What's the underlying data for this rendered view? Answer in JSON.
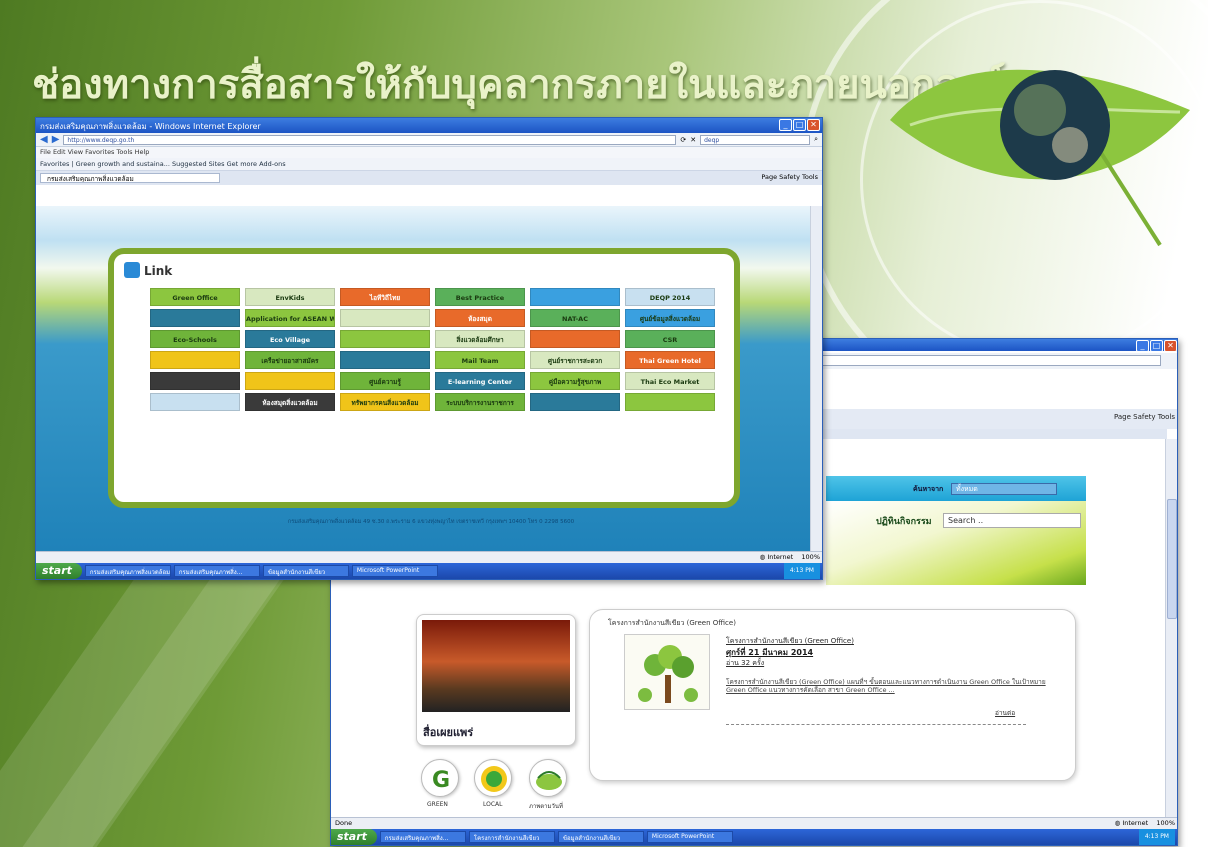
{
  "slide": {
    "title": "ช่องทางการสื่อสารให้กับบุคลากรภายในและภายนอกองค์กร",
    "accent_green": "#6e9a36",
    "ie_blue": "#2b5fb8"
  },
  "front_window": {
    "title_bar": "กรมส่งเสริมคุณภาพสิ่งแวดล้อม - Windows Internet Explorer",
    "address": "http://www.deqp.go.th",
    "search_engine": "deqp",
    "menu": "File  Edit  View  Favorites  Tools  Help",
    "favorites_bar": "Favorites  |  Green growth and sustaina...  Suggested Sites  Get more Add-ons",
    "tab_label": "กรมส่งเสริมคุณภาพสิ่งแวดล้อม",
    "command_bar": "Page  Safety  Tools",
    "link_heading": "Link",
    "banners": [
      [
        "Green Office",
        "EnvKids",
        "ไอทีวิถีไทย",
        "Best Practice",
        "",
        "DEQP 2014"
      ],
      [
        "",
        "Application for ASEAN Workshop",
        "",
        "ห้องสมุด",
        "NAT-AC",
        "ศูนย์ข้อมูลสิ่งแวดล้อม"
      ],
      [
        "Eco-Schools",
        "Eco Village",
        "",
        "สิ่งแวดล้อมศึกษา",
        "",
        "CSR"
      ],
      [
        "",
        "เครือข่ายอาสาสมัคร",
        "",
        "Mail Team",
        "ศูนย์ราชการสะดวก",
        "Thai Green Hotel"
      ],
      [
        "",
        "",
        "ศูนย์ความรู้",
        "E-learning Center",
        "คู่มือความรู้สุขภาพ",
        "Thai Eco Market"
      ],
      [
        "",
        "ห้องสมุดสิ่งแวดล้อม",
        "ทรัพยากรคนสิ่งแวดล้อม",
        "ระบบบริการงานราชการ",
        "",
        ""
      ]
    ],
    "footer_text": "กรมส่งเสริมคุณภาพสิ่งแวดล้อม 49 ซ.30 ถ.พระราม 6 แขวงทุ่งพญาไท เขตราชเทวี กรุงเทพฯ 10400 โทร 0 2298 5600",
    "status_zone": "Internet",
    "zoom": "100%",
    "taskbar": {
      "start": "start",
      "buttons": [
        "กรมส่งเสริมคุณภาพสิ่งแวดล้อม",
        "กรมส่งเสริมคุณภาพสิ่ง...",
        "ข้อมูลสำนักงานสีเขียว",
        "Microsoft PowerPoint"
      ],
      "tray_time": "4:13 PM"
    }
  },
  "back_window": {
    "command_bar": "Page  Safety  Tools",
    "select_label": "ค้นหาจาก",
    "select_value": "ทั้งหมด",
    "activity_label": "ปฏิทินกิจกรรม",
    "search_placeholder": "Search ..",
    "video_label": "สื่อเผยแพร่",
    "icons": [
      {
        "name": "green-icon",
        "label": "GREEN"
      },
      {
        "name": "local-icon",
        "label": "LOCAL"
      },
      {
        "name": "weather-icon",
        "label": "ภาพตามวันที่"
      }
    ],
    "news_header": "โครงการสำนักงานสีเขียว (Green Office)",
    "news_title": "โครงการสำนักงานสีเขียว (Green Office)",
    "news_date": "ศุกร์ที่ 21 มีนาคม 2014",
    "news_reads": "อ่าน 32 ครั้ง",
    "news_body": "โครงการสำนักงานสีเขียว (Green Office) แผนที่ฯ ขั้นตอนและแนวทางการดำเนินงาน Green Office ในเป้าหมาย Green Office แนวทางการคัดเลือก สาขา Green Office ...",
    "news_more": "อ่านต่อ",
    "status_left": "Done",
    "status_zone": "Internet",
    "zoom": "100%",
    "taskbar": {
      "start": "start",
      "buttons": [
        "กรมส่งเสริมคุณภาพสิ่ง...",
        "โครงการสำนักงานสีเขียว",
        "ข้อมูลสำนักงานสีเขียว",
        "Microsoft PowerPoint"
      ],
      "tray_time": "4:13 PM"
    }
  }
}
